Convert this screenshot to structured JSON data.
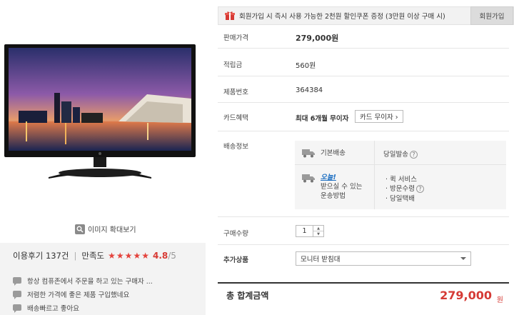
{
  "zoom": {
    "label": "이미지 확대보기"
  },
  "reviews": {
    "count_label": "이용후기 137건",
    "satisfaction_label": "만족도",
    "rating": "4.8",
    "rating_max": "/5",
    "stars": 5,
    "items": [
      "항상 컴퓨존에서 주문을 하고 있는 구매자 ...",
      "저렴한 가격에 좋은 제품 구입했네요",
      "배송빠르고 좋아요"
    ]
  },
  "promo": {
    "text": "회원가입 시 즉시 사용 가능한 2천원 할인쿠폰 증정 (3만원 이상 구매 시)",
    "button": "회원가입"
  },
  "info": {
    "price_label": "판매가격",
    "price": "279,000원",
    "points_label": "적립금",
    "points": "560원",
    "product_no_label": "제품번호",
    "product_no": "364384",
    "card_label": "카드혜택",
    "card_value": "최대 6개월 무이자",
    "card_button": "카드 무이자 ›",
    "shipping_label": "배송정보"
  },
  "shipping": {
    "basic_title": "기본배송",
    "basic_option": "당일발송",
    "alt_title_brand": "오늘!",
    "alt_title_line1": "받으실 수 있는",
    "alt_title_line2": "운송방법",
    "alt_options": [
      "· 퀵 서비스",
      "· 방문수령",
      "· 당일택배"
    ]
  },
  "qty": {
    "label": "구매수량",
    "value": "1"
  },
  "addon": {
    "label": "추가상품",
    "selected": "모니터 받침대"
  },
  "total": {
    "label": "총 합계금액",
    "value": "279,000",
    "unit": "원"
  },
  "colors": {
    "accent": "#d53a35",
    "link": "#1d6fc2",
    "panel": "#f3f3f3"
  }
}
